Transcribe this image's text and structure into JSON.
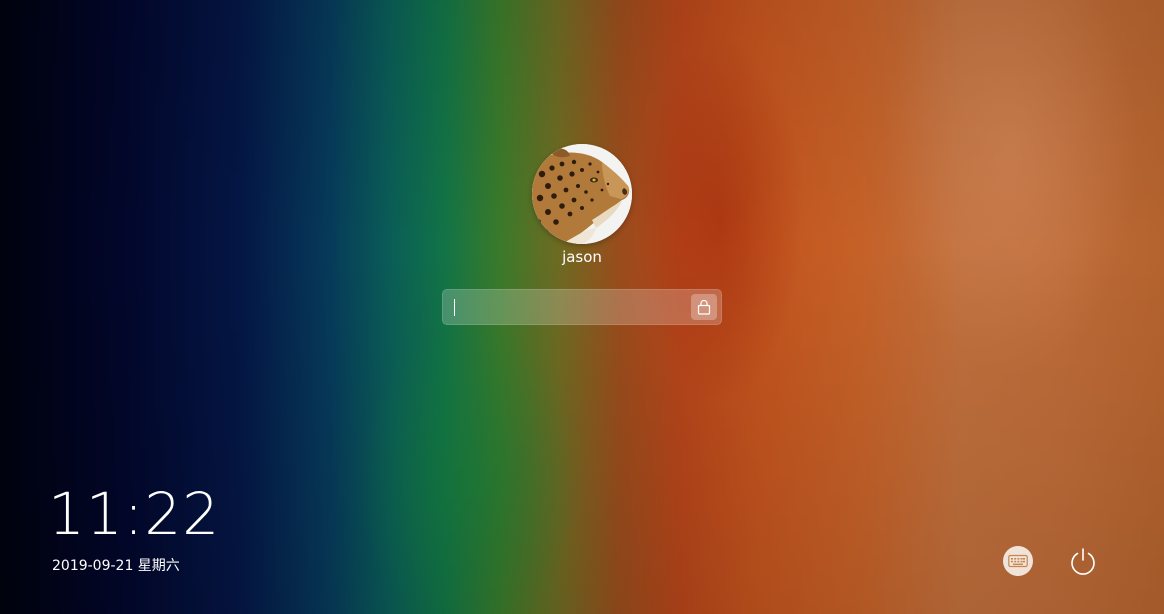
{
  "user": {
    "name": "jason",
    "avatar_icon": "leopard-avatar-icon"
  },
  "password": {
    "value": "",
    "placeholder": "",
    "submit_icon": "lock-icon"
  },
  "clock": {
    "time": "11:22",
    "date": "2019-09-21 星期六"
  },
  "controls": {
    "keyboard_icon": "keyboard-icon",
    "power_icon": "power-icon"
  },
  "colors": {
    "text": "#ffffff",
    "input_bg": "rgba(255,255,255,0.22)"
  }
}
